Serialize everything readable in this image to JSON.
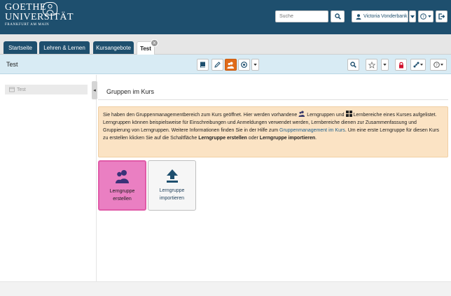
{
  "logo": {
    "line1": "GOETHE",
    "line2": "UNIVERSITÄT",
    "line3": "FRANKFURT AM MAIN"
  },
  "header": {
    "search_placeholder": "Suche",
    "user_name": "Victoria Vonderbank",
    "icons": [
      "search-icon",
      "user-icon",
      "caret-down-icon",
      "help-icon",
      "logout-icon"
    ]
  },
  "tabs": [
    {
      "label": "Startseite",
      "active": false
    },
    {
      "label": "Lehren & Lernen",
      "active": false
    },
    {
      "label": "Kursangebote",
      "active": false
    },
    {
      "label": "Test",
      "active": true
    }
  ],
  "course": {
    "title": "Test",
    "toolbar_left_icons": [
      "book-icon",
      "pencil-icon",
      "group-icon",
      "target-icon",
      "caret-down-icon"
    ],
    "toolbar_right_icons": [
      "search-icon",
      "star-icon",
      "caret-down-icon",
      "lock-icon",
      "network-icon",
      "help-icon"
    ]
  },
  "sidebar": {
    "items": [
      {
        "label": "Test"
      }
    ]
  },
  "main": {
    "title": "Gruppen im Kurs",
    "info": {
      "p1": "Sie haben den Gruppenmanagementbereich zum Kurs geöffnet. Hier werden vorhandene",
      "p2": "Lerngruppen und",
      "p3": "Lernbereiche eines Kurses aufgelistet. Lerngruppen können beispielsweise für Einschreibungen und Anmeldungen verwendet werden, Lernbereiche dienen zur Zusammenfassung und Gruppierung von Lerngruppen. Weitere Informationen finden Sie in der Hilfe zum",
      "link": "Gruppenmanagement im Kurs",
      "p4": ". Um eine erste Lerngruppe für diesen Kurs zu erstellen klicken Sie auf die Schaltfläche",
      "b1": "Lerngruppe erstellen",
      "p5": "oder",
      "b2": "Lerngruppe importieren",
      "p6": "."
    },
    "tiles": [
      {
        "line1": "Lerngruppe",
        "line2": "erstellen"
      },
      {
        "line1": "Lerngruppe",
        "line2": "importieren"
      }
    ]
  },
  "colors": {
    "header_bg": "#1e4f6e",
    "accent_orange": "#e06b1a",
    "info_bg": "#fbe3c4",
    "tile_pink": "#ea7fc2",
    "link_blue": "#1e5f8c",
    "lock_red": "#d0122e"
  }
}
